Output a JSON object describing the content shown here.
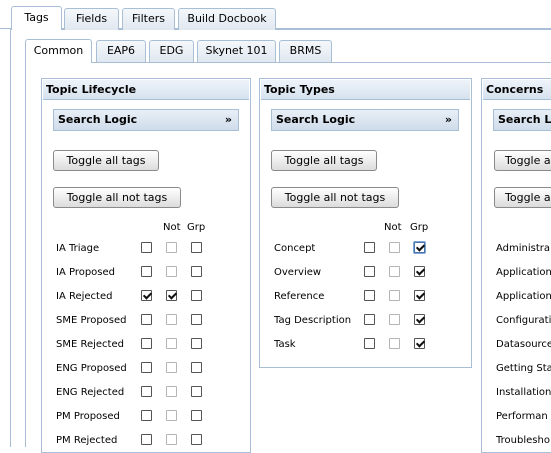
{
  "top_tabs": [
    {
      "label": "Tags",
      "active": true
    },
    {
      "label": "Fields",
      "active": false
    },
    {
      "label": "Filters",
      "active": false
    },
    {
      "label": "Build Docbook",
      "active": false
    }
  ],
  "sub_tabs": [
    {
      "label": "Common",
      "active": true
    },
    {
      "label": "EAP6",
      "active": false
    },
    {
      "label": "EDG",
      "active": false
    },
    {
      "label": "Skynet 101",
      "active": false
    },
    {
      "label": "BRMS",
      "active": false
    }
  ],
  "panels": {
    "lifecycle": {
      "title": "Topic Lifecycle",
      "search_logic": "Search Logic",
      "search_chevron": "»",
      "toggle_all": "Toggle all tags",
      "toggle_all_not": "Toggle all not tags",
      "col_not": "Not",
      "col_grp": "Grp",
      "rows": [
        {
          "label": "IA Triage",
          "checked": false,
          "not": false,
          "grp": false
        },
        {
          "label": "IA Proposed",
          "checked": false,
          "not": false,
          "grp": false
        },
        {
          "label": "IA Rejected",
          "checked": true,
          "not": true,
          "grp": false
        },
        {
          "label": "SME Proposed",
          "checked": false,
          "not": false,
          "grp": false
        },
        {
          "label": "SME Rejected",
          "checked": false,
          "not": false,
          "grp": false
        },
        {
          "label": "ENG Proposed",
          "checked": false,
          "not": false,
          "grp": false
        },
        {
          "label": "ENG Rejected",
          "checked": false,
          "not": false,
          "grp": false
        },
        {
          "label": "PM Proposed",
          "checked": false,
          "not": false,
          "grp": false
        },
        {
          "label": "PM Rejected",
          "checked": false,
          "not": false,
          "grp": false
        }
      ]
    },
    "types": {
      "title": "Topic Types",
      "search_logic": "Search Logic",
      "search_chevron": "»",
      "toggle_all": "Toggle all tags",
      "toggle_all_not": "Toggle all not tags",
      "col_not": "Not",
      "col_grp": "Grp",
      "rows": [
        {
          "label": "Concept",
          "checked": false,
          "not": false,
          "grp": true
        },
        {
          "label": "Overview",
          "checked": false,
          "not": false,
          "grp": true
        },
        {
          "label": "Reference",
          "checked": false,
          "not": false,
          "grp": true
        },
        {
          "label": "Tag Description",
          "checked": false,
          "not": false,
          "grp": true
        },
        {
          "label": "Task",
          "checked": false,
          "not": false,
          "grp": true
        }
      ]
    },
    "concerns": {
      "title": "Concerns",
      "search_logic": "Search Lo",
      "toggle_all": "Toggle a",
      "toggle_all_not": "Toggle a",
      "rows": [
        {
          "label": "Administra"
        },
        {
          "label": "Application"
        },
        {
          "label": "Application"
        },
        {
          "label": "Configurati"
        },
        {
          "label": "Datasource"
        },
        {
          "label": "Getting Sta"
        },
        {
          "label": "Installation"
        },
        {
          "label": "Performan"
        },
        {
          "label": "Troublesho"
        }
      ]
    }
  }
}
